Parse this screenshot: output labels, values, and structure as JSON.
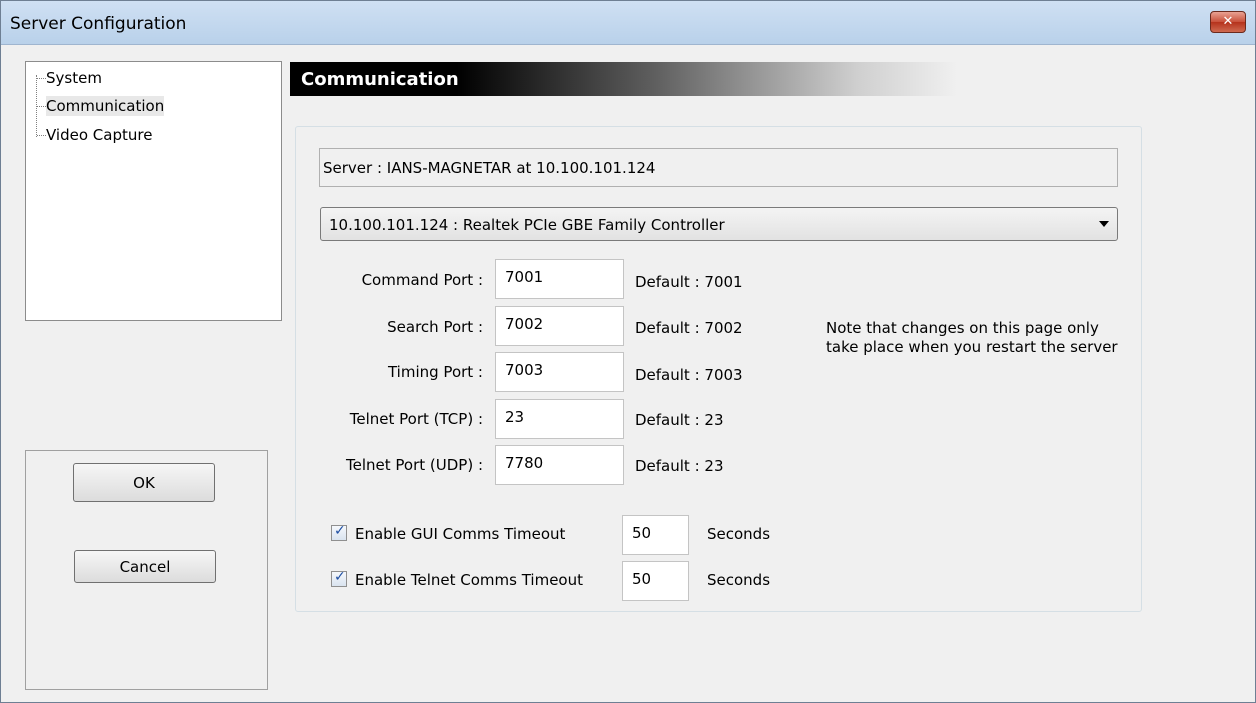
{
  "window": {
    "title": "Server Configuration",
    "close_glyph": "✕"
  },
  "tree": {
    "items": [
      {
        "label": "System"
      },
      {
        "label": "Communication"
      },
      {
        "label": "Video Capture"
      }
    ]
  },
  "buttons": {
    "ok_label": "OK",
    "cancel_label": "Cancel"
  },
  "section": {
    "title": "Communication"
  },
  "server": {
    "info": "Server : IANS-MAGNETAR  at  10.100.101.124"
  },
  "adapter": {
    "selected": "10.100.101.124 : Realtek PCIe GBE Family Controller"
  },
  "ports": [
    {
      "label": "Command Port :",
      "value": "7001",
      "default": "Default : 7001"
    },
    {
      "label": "Search Port :",
      "value": "7002",
      "default": "Default : 7002"
    },
    {
      "label": "Timing Port :",
      "value": "7003",
      "default": "Default : 7003"
    },
    {
      "label": "Telnet Port (TCP) :",
      "value": "23",
      "default": "Default : 23"
    },
    {
      "label": "Telnet Port (UDP) :",
      "value": "7780",
      "default": "Default : 23"
    }
  ],
  "note": "Note that changes on this page only take place when you restart the server",
  "timeouts": [
    {
      "label": "Enable GUI Comms Timeout",
      "checked": true,
      "value": "50",
      "unit": "Seconds"
    },
    {
      "label": "Enable Telnet Comms Timeout",
      "checked": true,
      "value": "50",
      "unit": "Seconds"
    }
  ],
  "colors": {
    "title_bar": "#c4d9ef",
    "close_button": "#c8503a",
    "header_bg": "#000000",
    "check": "#1f4fa3"
  }
}
